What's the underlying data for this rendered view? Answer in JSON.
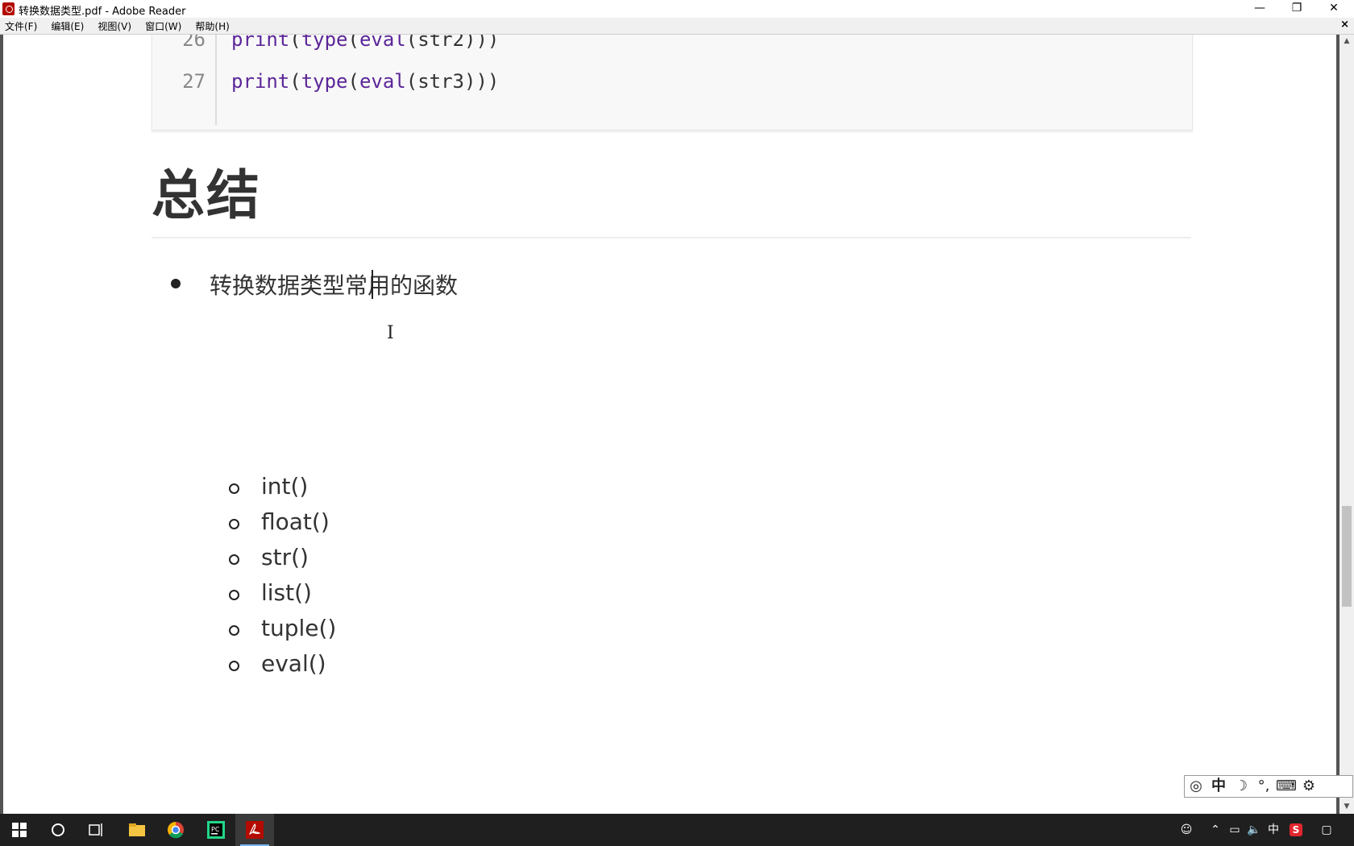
{
  "window": {
    "title": "转换数据类型.pdf - Adobe Reader",
    "minimize": "—",
    "restore": "❐",
    "close": "✕"
  },
  "menu": {
    "items": [
      "文件(F)",
      "编辑(E)",
      "视图(V)",
      "窗口(W)",
      "帮助(H)"
    ],
    "doc_close": "×"
  },
  "document": {
    "code": [
      {
        "line": "26",
        "keyword": "print",
        "open1": "(",
        "fn": "type",
        "open2": "(",
        "fn2": "eval",
        "rest": "(str2)))"
      },
      {
        "line": "27",
        "keyword": "print",
        "open1": "(",
        "fn": "type",
        "open2": "(",
        "fn2": "eval",
        "rest": "(str3)))"
      }
    ],
    "heading": "总结",
    "bullet": "转换数据类型常用的函数",
    "sub_items": [
      "int()",
      "float()",
      "str()",
      "list()",
      "tuple()",
      "eval()"
    ]
  },
  "ime": {
    "icons": [
      "ime-logo-icon",
      "chinese-mode-icon",
      "half-width-moon-icon",
      "punctuation-icon",
      "soft-keyboard-icon",
      "settings-gear-icon"
    ],
    "mode_label": "中"
  },
  "taskbar": {
    "apps": [
      "start-icon",
      "search-icon",
      "task-view-icon",
      "file-explorer-icon",
      "chrome-icon",
      "pycharm-icon",
      "adobe-reader-icon"
    ],
    "input_lang": "中"
  },
  "colors": {
    "taskbar": "#1f1f1f",
    "viewport_bg": "#545454",
    "code_keyword": "#5c2699",
    "code_function": "#1c00cf"
  }
}
